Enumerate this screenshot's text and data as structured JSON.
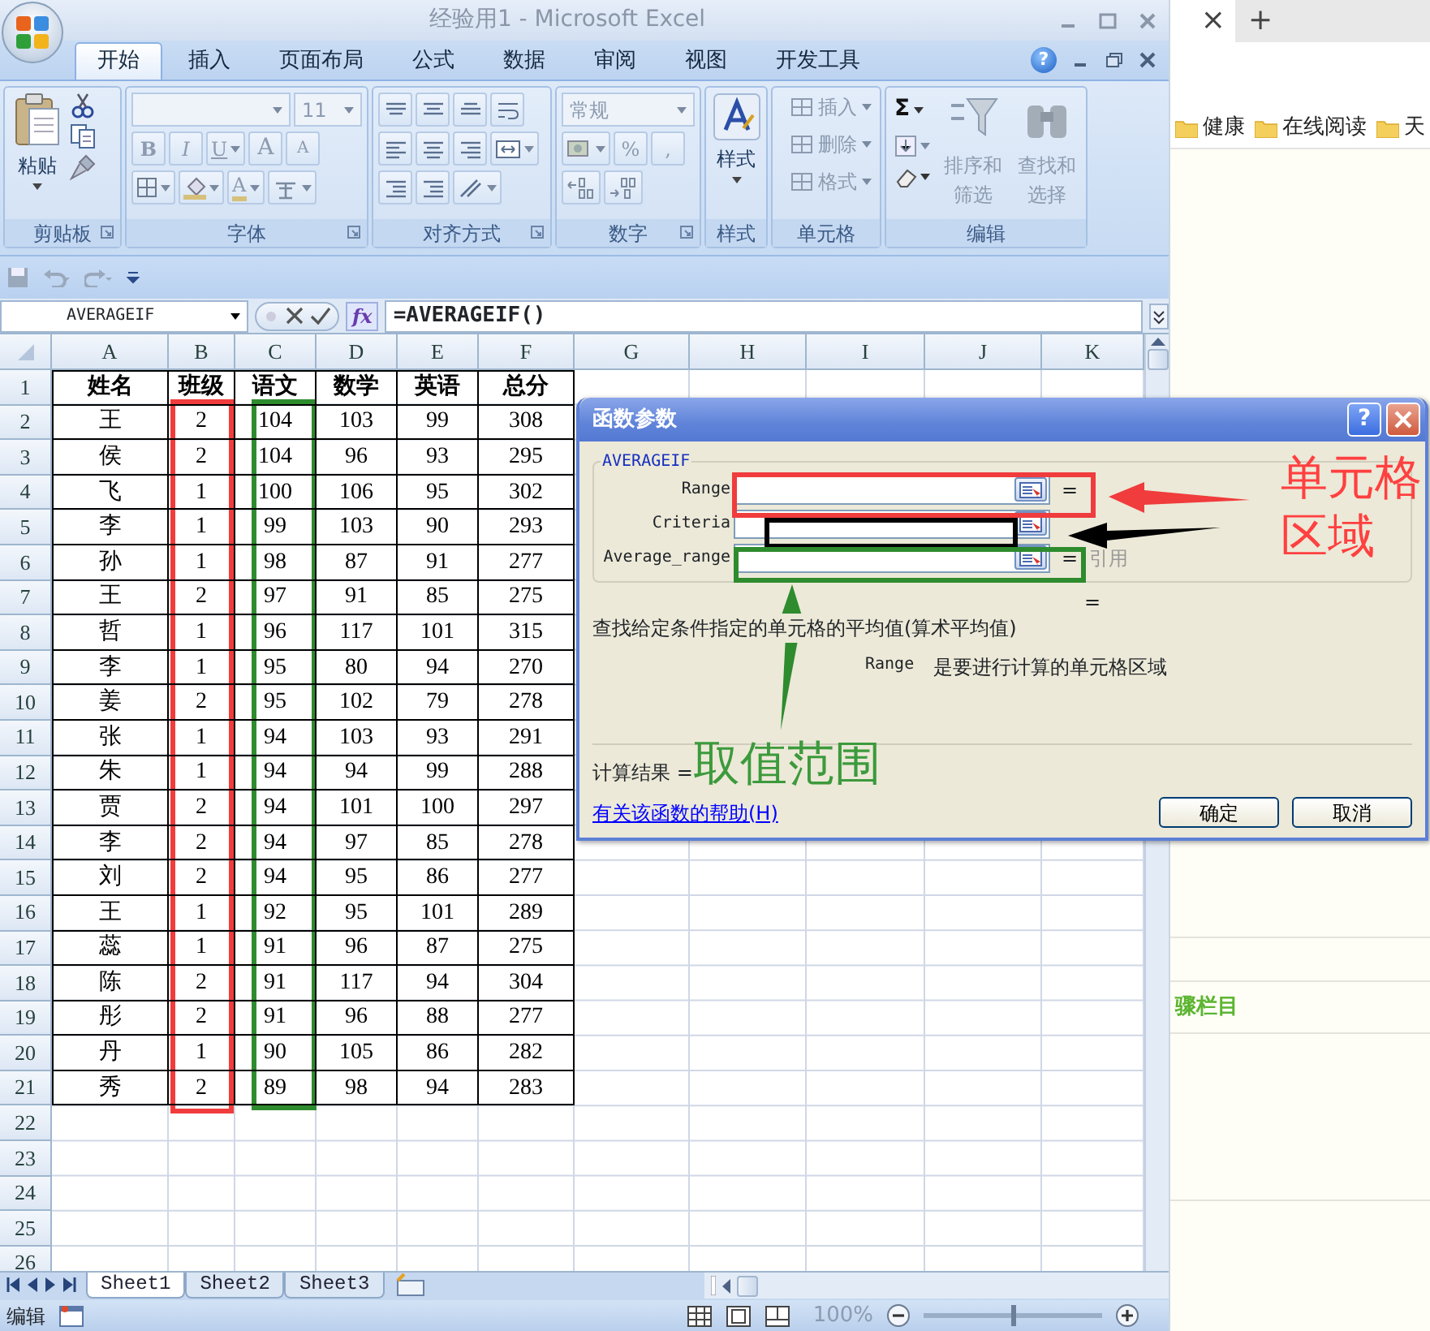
{
  "window": {
    "title": "经验用1 - Microsoft Excel"
  },
  "ribbon_tabs": [
    {
      "label": "开始",
      "selected": true
    },
    {
      "label": "插入",
      "selected": false
    },
    {
      "label": "页面布局",
      "selected": false
    },
    {
      "label": "公式",
      "selected": false
    },
    {
      "label": "数据",
      "selected": false
    },
    {
      "label": "审阅",
      "selected": false
    },
    {
      "label": "视图",
      "selected": false
    },
    {
      "label": "开发工具",
      "selected": false
    }
  ],
  "help": "?",
  "ribbon_groups": [
    {
      "label": "剪贴板",
      "texts": [
        "粘贴"
      ]
    },
    {
      "label": "字体",
      "texts": [
        "11",
        "B",
        "I",
        "U",
        "A",
        "A",
        "A"
      ]
    },
    {
      "label": "对齐方式"
    },
    {
      "label": "数字",
      "texts": [
        "常规",
        "%",
        ","
      ]
    },
    {
      "label": "样式",
      "texts": [
        "样式"
      ]
    },
    {
      "label": "单元格",
      "texts": [
        "插入",
        "删除",
        "格式"
      ]
    },
    {
      "label": "编辑",
      "texts": [
        "Σ",
        "排序和筛选",
        "查找和选择"
      ]
    }
  ],
  "formula_bar": {
    "name_box": "AVERAGEIF",
    "fx": "fx",
    "formula": "=AVERAGEIF()"
  },
  "sheet": {
    "columns": [
      "A",
      "B",
      "C",
      "D",
      "E",
      "F",
      "G",
      "H",
      "I",
      "J",
      "K"
    ],
    "row_numbers": [
      "1",
      "2",
      "3",
      "4",
      "5",
      "6",
      "7",
      "8",
      "9",
      "10",
      "11",
      "12",
      "13",
      "14",
      "15",
      "16",
      "17",
      "18",
      "19",
      "20",
      "21",
      "22",
      "23",
      "24",
      "25",
      "26"
    ],
    "header": [
      "姓名",
      "班级",
      "语文",
      "数学",
      "英语",
      "总分"
    ],
    "rows": [
      [
        "王",
        "2",
        "104",
        "103",
        "99",
        "308"
      ],
      [
        "侯",
        "2",
        "104",
        "96",
        "93",
        "295"
      ],
      [
        "飞",
        "1",
        "100",
        "106",
        "95",
        "302"
      ],
      [
        "李",
        "1",
        "99",
        "103",
        "90",
        "293"
      ],
      [
        "孙",
        "1",
        "98",
        "87",
        "91",
        "277"
      ],
      [
        "王",
        "2",
        "97",
        "91",
        "85",
        "275"
      ],
      [
        "哲",
        "1",
        "96",
        "117",
        "101",
        "315"
      ],
      [
        "李",
        "1",
        "95",
        "80",
        "94",
        "270"
      ],
      [
        "姜",
        "2",
        "95",
        "102",
        "79",
        "278"
      ],
      [
        "张",
        "1",
        "94",
        "103",
        "93",
        "291"
      ],
      [
        "朱",
        "1",
        "94",
        "94",
        "99",
        "288"
      ],
      [
        "贾",
        "2",
        "94",
        "101",
        "100",
        "297"
      ],
      [
        "李",
        "2",
        "94",
        "97",
        "85",
        "278"
      ],
      [
        "刘",
        "2",
        "94",
        "95",
        "86",
        "277"
      ],
      [
        "王",
        "1",
        "92",
        "95",
        "101",
        "289"
      ],
      [
        "蕊",
        "1",
        "91",
        "96",
        "87",
        "275"
      ],
      [
        "陈",
        "2",
        "91",
        "117",
        "94",
        "304"
      ],
      [
        "彤",
        "2",
        "91",
        "96",
        "88",
        "277"
      ],
      [
        "丹",
        "1",
        "90",
        "105",
        "86",
        "282"
      ],
      [
        "秀",
        "2",
        "89",
        "98",
        "94",
        "283"
      ]
    ]
  },
  "sheet_tabs": [
    {
      "label": "Sheet1",
      "selected": true
    },
    {
      "label": "Sheet2",
      "selected": false
    },
    {
      "label": "Sheet3",
      "selected": false
    }
  ],
  "status_bar": {
    "mode": "编辑",
    "zoom": "100%",
    "zoom_slider": {
      "level": 0.5
    }
  },
  "dialog": {
    "title": "函数参数",
    "help": "?",
    "function": "AVERAGEIF",
    "args": [
      {
        "label": "Range",
        "eq": "="
      },
      {
        "label": "Criteria"
      },
      {
        "label": "Average_range",
        "eq": "=",
        "hint": "引用"
      }
    ],
    "value_eq": "=",
    "description": "查找给定条件指定的单元格的平均值(算术平均值)",
    "arg_help": {
      "name": "Range",
      "text": "是要进行计算的单元格区域"
    },
    "result_label": "计算结果 =",
    "help_link": "有关该函数的帮助(H)",
    "buttons": [
      "确定",
      "取消"
    ]
  },
  "annotations": [
    {
      "text": "单元格",
      "color": "#ff4040"
    },
    {
      "text": "区域",
      "color": "#ff4040"
    },
    {
      "text": "取值范围",
      "color": "#3c9a3c"
    }
  ],
  "browser": {
    "close": "×",
    "new_tab": "+",
    "bookmarks": [
      "健康",
      "在线阅读",
      "天"
    ],
    "section_title": "骤栏目"
  }
}
